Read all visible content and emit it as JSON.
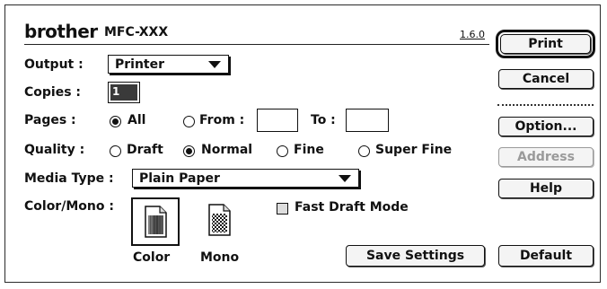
{
  "header": {
    "brand": "brother",
    "model": "MFC-XXX",
    "version": "1.6.0"
  },
  "output": {
    "label": "Output :",
    "value": "Printer"
  },
  "copies": {
    "label": "Copies :",
    "value": "1"
  },
  "pages": {
    "label": "Pages :",
    "all_label": "All",
    "from_label": "From :",
    "to_label": "To :",
    "from_value": "",
    "to_value": "",
    "selected": "All"
  },
  "quality": {
    "label": "Quality :",
    "options": [
      "Draft",
      "Normal",
      "Fine",
      "Super Fine"
    ],
    "selected": "Normal"
  },
  "media_type": {
    "label": "Media Type :",
    "value": "Plain Paper"
  },
  "color_mono": {
    "label": "Color/Mono :",
    "color_label": "Color",
    "mono_label": "Mono",
    "selected": "Color"
  },
  "fast_draft": {
    "label": "Fast Draft Mode",
    "checked": false
  },
  "buttons": {
    "print": "Print",
    "cancel": "Cancel",
    "option": "Option...",
    "address": "Address",
    "help": "Help",
    "save_settings": "Save Settings",
    "default": "Default"
  },
  "icons": {
    "color": "color-document-icon",
    "mono": "mono-document-icon"
  }
}
